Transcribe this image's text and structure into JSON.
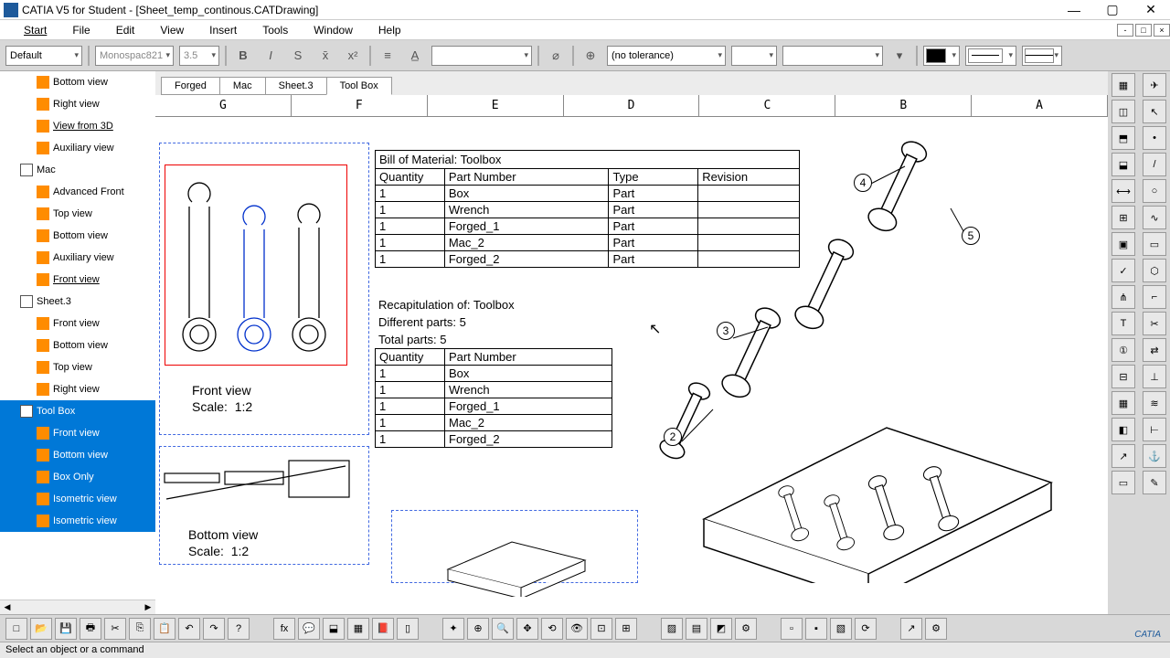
{
  "window": {
    "title": "CATIA V5 for Student - [Sheet_temp_continous.CATDrawing]"
  },
  "menu": [
    "Start",
    "File",
    "Edit",
    "View",
    "Insert",
    "Tools",
    "Window",
    "Help"
  ],
  "toolbar": {
    "style_combo": "Default",
    "font_combo": "Monospac821",
    "size_combo": "3.5",
    "tolerance": "(no tolerance)"
  },
  "tree": [
    {
      "label": "Bottom view",
      "level": 2,
      "sel": false
    },
    {
      "label": "Right view",
      "level": 2,
      "sel": false
    },
    {
      "label": "View from 3D",
      "level": 2,
      "sel": false,
      "ul": true
    },
    {
      "label": "Auxiliary view",
      "level": 2,
      "sel": false
    },
    {
      "label": "Mac",
      "level": 1,
      "sel": false,
      "sheet": true
    },
    {
      "label": "Advanced Front",
      "level": 2,
      "sel": false
    },
    {
      "label": "Top view",
      "level": 2,
      "sel": false
    },
    {
      "label": "Bottom view",
      "level": 2,
      "sel": false
    },
    {
      "label": "Auxiliary view",
      "level": 2,
      "sel": false
    },
    {
      "label": "Front view",
      "level": 2,
      "sel": false,
      "ul": true
    },
    {
      "label": "Sheet.3",
      "level": 1,
      "sel": false,
      "sheet": true
    },
    {
      "label": "Front view",
      "level": 2,
      "sel": false
    },
    {
      "label": "Bottom view",
      "level": 2,
      "sel": false
    },
    {
      "label": "Top view",
      "level": 2,
      "sel": false
    },
    {
      "label": "Right view",
      "level": 2,
      "sel": false
    },
    {
      "label": "Tool Box",
      "level": 1,
      "sel": true,
      "sheet": true
    },
    {
      "label": "Front view",
      "level": 2,
      "sel": true
    },
    {
      "label": "Bottom view",
      "level": 2,
      "sel": true
    },
    {
      "label": "Box Only",
      "level": 2,
      "sel": true
    },
    {
      "label": "Isometric view",
      "level": 2,
      "sel": true
    },
    {
      "label": "Isometric view",
      "level": 2,
      "sel": true
    }
  ],
  "tabs": [
    "Forged",
    "Mac",
    "Sheet.3",
    "Tool Box"
  ],
  "ruler": [
    "G",
    "F",
    "E",
    "D",
    "C",
    "B",
    "A"
  ],
  "bom": {
    "title": "Bill of Material: Toolbox",
    "headers": [
      "Quantity",
      "Part Number",
      "Type",
      "Revision"
    ],
    "rows": [
      [
        "1",
        "Box",
        "Part",
        ""
      ],
      [
        "1",
        "Wrench",
        "Part",
        ""
      ],
      [
        "1",
        "Forged_1",
        "Part",
        ""
      ],
      [
        "1",
        "Mac_2",
        "Part",
        ""
      ],
      [
        "1",
        "Forged_2",
        "Part",
        ""
      ]
    ]
  },
  "recap": {
    "title": "Recapitulation of: Toolbox",
    "diff": "Different parts: 5",
    "total": "Total parts: 5",
    "headers": [
      "Quantity",
      "Part Number"
    ],
    "rows": [
      [
        "1",
        "Box"
      ],
      [
        "1",
        "Wrench"
      ],
      [
        "1",
        "Forged_1"
      ],
      [
        "1",
        "Mac_2"
      ],
      [
        "1",
        "Forged_2"
      ]
    ]
  },
  "views": {
    "front": "Front view\nScale:  1:2",
    "bottom": "Bottom view\nScale:  1:2"
  },
  "callouts": [
    "2",
    "3",
    "4",
    "5"
  ],
  "status": "Select an object or a command",
  "logo": "CATIA"
}
